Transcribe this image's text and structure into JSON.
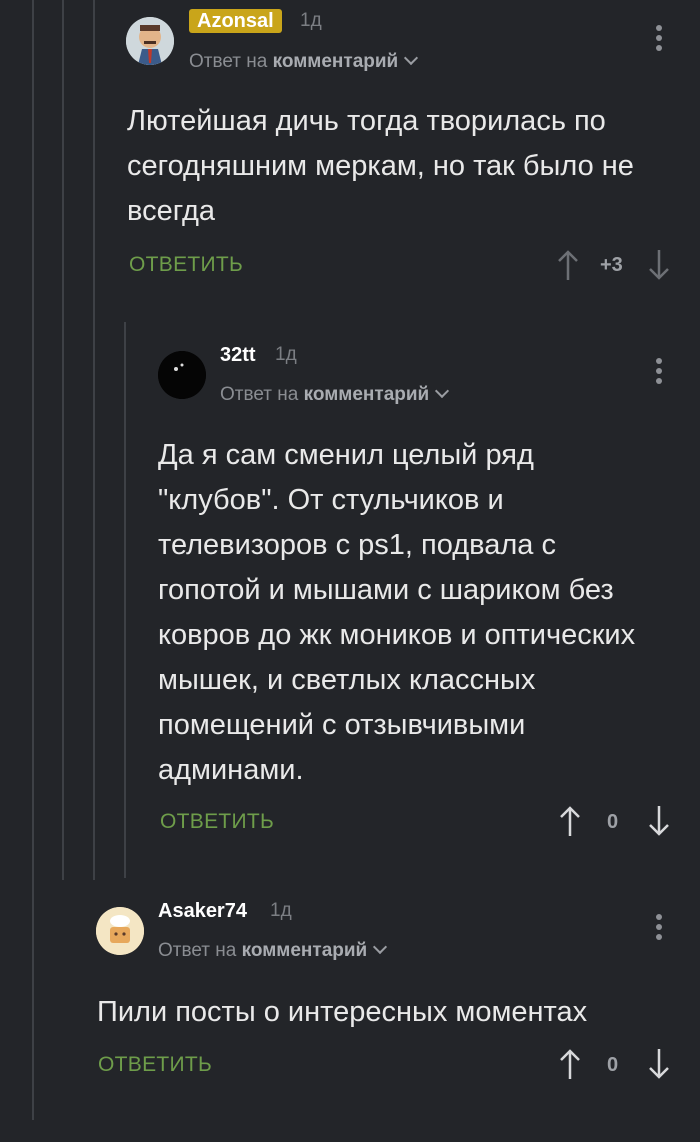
{
  "comments": [
    {
      "author": "Azonsal",
      "time": "1д",
      "reply_prefix": "Ответ на",
      "reply_target": "комментарий",
      "text": "Лютейшая дичь тогда творилась по сегодняшним меркам, но так было не всегда",
      "reply_label": "ОТВЕТИТЬ",
      "score": "+3"
    },
    {
      "author": "32tt",
      "time": "1д",
      "reply_prefix": "Ответ на",
      "reply_target": "комментарий",
      "text": "Да я сам сменил целый ряд \"клубов\". От стульчиков и телевизоров с ps1, подвала с гопотой и мышами с шариком без ковров до жк моников и оптических мышек, и светлых классных помещений с отзывчивыми админами.",
      "reply_label": "ОТВЕТИТЬ",
      "score": "0"
    },
    {
      "author": "Asaker74",
      "time": "1д",
      "reply_prefix": "Ответ на",
      "reply_target": "комментарий",
      "text": "Пили посты о интересных моментах",
      "reply_label": "ОТВЕТИТЬ",
      "score": "0"
    }
  ],
  "colors": {
    "background": "#232529",
    "reply_action": "#6e9d4a",
    "badge": "#c9a51a",
    "thread_line": "#3e4146"
  }
}
